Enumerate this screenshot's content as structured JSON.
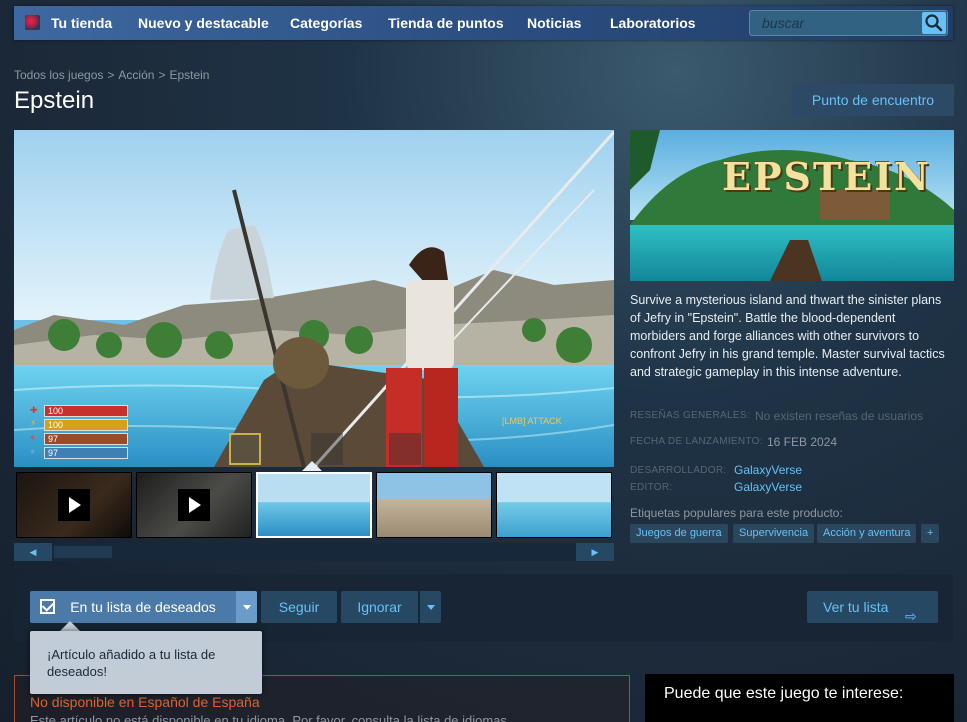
{
  "nav": {
    "store": "Tu tienda",
    "new": "Nuevo y destacable",
    "categories": "Categorías",
    "points": "Tienda de puntos",
    "news": "Noticias",
    "labs": "Laboratorios",
    "search_placeholder": "buscar"
  },
  "breadcrumb": [
    "Todos los juegos",
    "Acción",
    "Epstein"
  ],
  "title": "Epstein",
  "hub_button": "Punto de encuentro",
  "capsule_logo": "EPSTEIN",
  "hud": {
    "health": "100",
    "stamina": "100",
    "food": "97",
    "water": "97",
    "attack_hint": "[LMB] ATTACK"
  },
  "description": "Survive a mysterious island and thwart the sinister plans of Jefry in \"Epstein\". Battle the blood-dependent morbiders and forge alliances with other survivors to confront Jefry in his grand temple. Master survival tactics and strategic gameplay in this intense adventure.",
  "info": {
    "reviews_label": "RESEÑAS GENERALES:",
    "reviews_value": "No existen reseñas de usuarios",
    "release_label": "FECHA DE LANZAMIENTO:",
    "release_value": "16 FEB 2024",
    "developer_label": "DESARROLLADOR:",
    "developer_value": "GalaxyVerse",
    "publisher_label": "EDITOR:",
    "publisher_value": "GalaxyVerse"
  },
  "tags_heading": "Etiquetas populares para este producto:",
  "tags": [
    "Juegos de guerra",
    "Supervivencia",
    "Acción y aventura",
    "+"
  ],
  "actions": {
    "wishlist": "En tu lista de deseados",
    "follow": "Seguir",
    "ignore": "Ignorar",
    "queue": "Ver tu lista"
  },
  "tooltip": "¡Artículo añadido a tu lista de deseados!",
  "language": {
    "title": "No disponible en Español de España",
    "text": "Este artículo no está disponible en tu idioma. Por favor, consulta la lista de idiomas"
  },
  "recommendation_title": "Puede que este juego te interese:",
  "colors": {
    "accent": "#67c1f5",
    "background": "#1b2838",
    "warning": "#e0612d"
  }
}
